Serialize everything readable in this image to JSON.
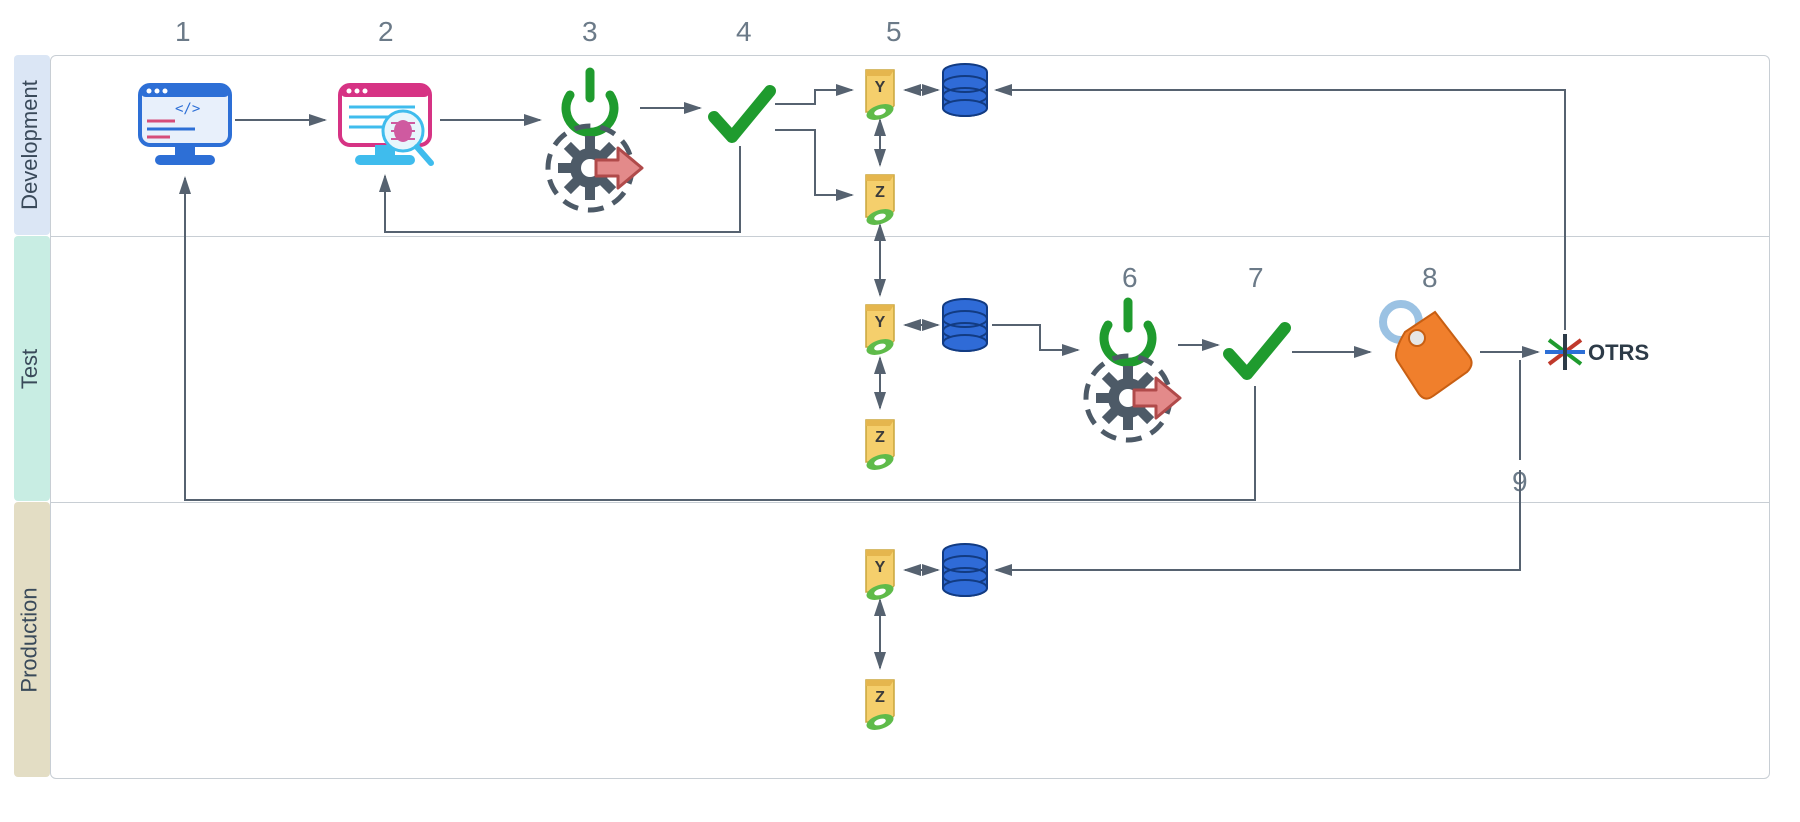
{
  "lanes": {
    "dev": "Development",
    "test": "Test",
    "prod": "Production"
  },
  "steps": {
    "1": "1",
    "2": "2",
    "3": "3",
    "4": "4",
    "5": "5",
    "6": "6",
    "7": "7",
    "8": "8",
    "9": "9"
  },
  "server_labels": {
    "y": "Y",
    "z": "Z"
  },
  "brand": {
    "otrs": "OTRS"
  },
  "colors": {
    "lane_dev": "#dbe6f5",
    "lane_test": "#c8ede3",
    "lane_prod": "#e3ddc4",
    "arrow": "#566270",
    "db_blue": "#2f6bd7",
    "db_blue_dark": "#123b82",
    "green": "#1f9b2e",
    "gear": "#4d5a67",
    "gear_arrow_fill": "#e38a8a",
    "gear_arrow_stroke": "#b04a4a",
    "tag_fill": "#f07f2c",
    "tag_ring": "#9bc2e3",
    "tag_hole": "#e6e6e6",
    "server_card": "#f5cf6c",
    "server_card_top": "#e5b64e",
    "candy_green": "#5fbb4a",
    "candy_white": "#ffffff"
  }
}
